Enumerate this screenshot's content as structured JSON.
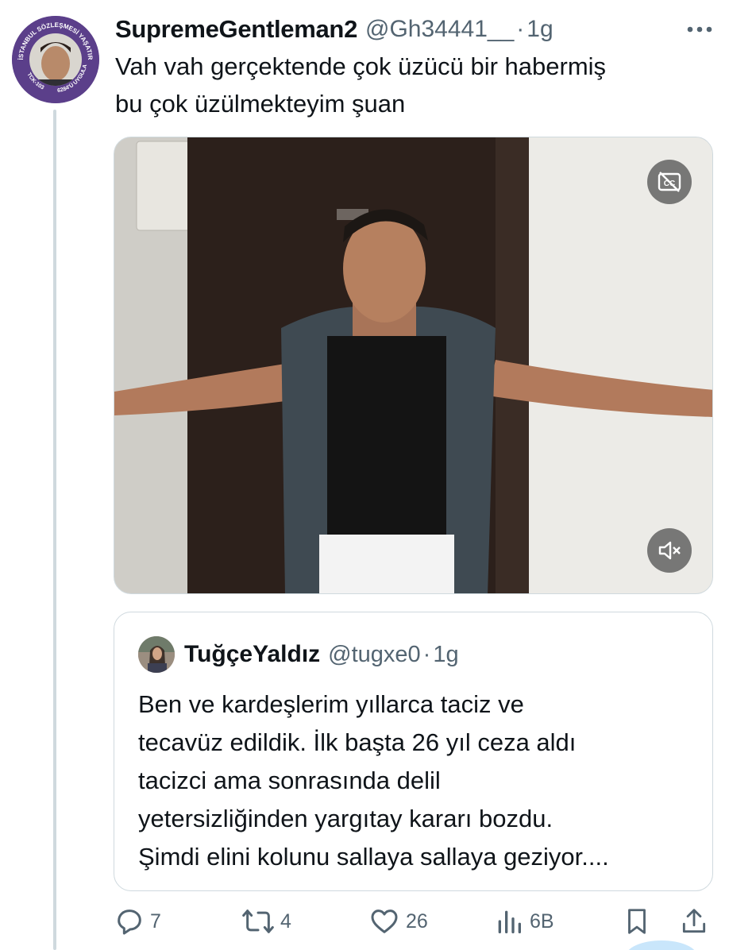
{
  "tweet": {
    "display_name": "SupremeGentleman2",
    "handle": "@Gh34441__",
    "dot": "·",
    "time": "1g",
    "text_lines": [
      "Vah vah gerçektende çok üzücü bir habermiş",
      "bu çok üzülmekteyim şuan"
    ],
    "avatar_ring_text": {
      "top": "İSTANBUL SÖZLEŞMESİ YAŞATIR",
      "bottom_left": "TCK-103",
      "bottom_right": "6284'Ü UYGULA"
    }
  },
  "media": {
    "cc_icon": "captions-off-icon",
    "mute_icon": "volume-muted-icon"
  },
  "quote": {
    "display_name": "TuğçeYaldız",
    "handle": "@tugxe0",
    "dot": "·",
    "time": "1g",
    "text_lines": [
      "Ben ve kardeşlerim yıllarca taciz ve",
      "tecavüz edildik. İlk başta 26 yıl ceza aldı",
      "tacizci ama sonrasında delil",
      "yetersizliğinden yargıtay kararı bozdu.",
      "Şimdi elini kolunu sallaya sallaya geziyor...."
    ]
  },
  "actions": {
    "reply_count": "7",
    "retweet_count": "4",
    "like_count": "26",
    "views_count": "6B"
  },
  "colors": {
    "text_primary": "#0f1419",
    "text_secondary": "#536471",
    "border": "#cfd9de",
    "avatar_ring": "#5b3f8a"
  }
}
